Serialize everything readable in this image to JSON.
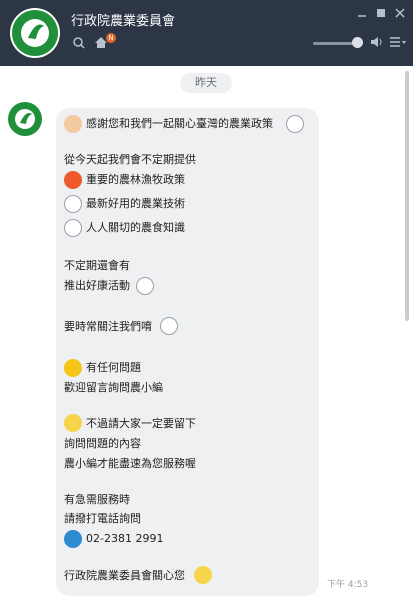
{
  "app": {
    "title": "行政院農業委員會",
    "brand_color": "#1f8f3a",
    "header_color": "#2c3645"
  },
  "header": {
    "search_icon": "search-icon",
    "home_icon": "home-icon",
    "badge": "N",
    "minimize_icon": "minimize-icon",
    "restore_icon": "restore-icon",
    "close_icon": "close-icon",
    "volume_icon": "speaker-icon",
    "menu_icon": "menu-icon",
    "volume_level": 0.8
  },
  "chat": {
    "date_label": "昨天",
    "time": "下午 4:53",
    "message_lines": [
      "感謝您和我們一起關心臺灣的農業政策",
      "從今天起我們會不定期提供",
      "重要的農林漁牧政策",
      "最新好用的農業技術",
      "人人關切的農食知識",
      "不定期還會有",
      "推出好康活動",
      "要時常關注我們唷",
      "有任何問題",
      "歡迎留言詢問農小編",
      "不過請大家一定要留下",
      "詢問問題的內容",
      "農小編才能盡速為您服務喔",
      "有急需服務時",
      "請撥打電話詢問",
      "02-2381 2991",
      "行政院農業委員會關心您"
    ]
  },
  "emoji_names": [
    "thumbs-up-icon",
    "bunny-icon",
    "fire-icon",
    "bunny-icon",
    "bunny-icon",
    "bunny-icon",
    "bunny-icon",
    "star-icon",
    "lightbulb-icon",
    "telephone-icon",
    "girl-icon"
  ]
}
